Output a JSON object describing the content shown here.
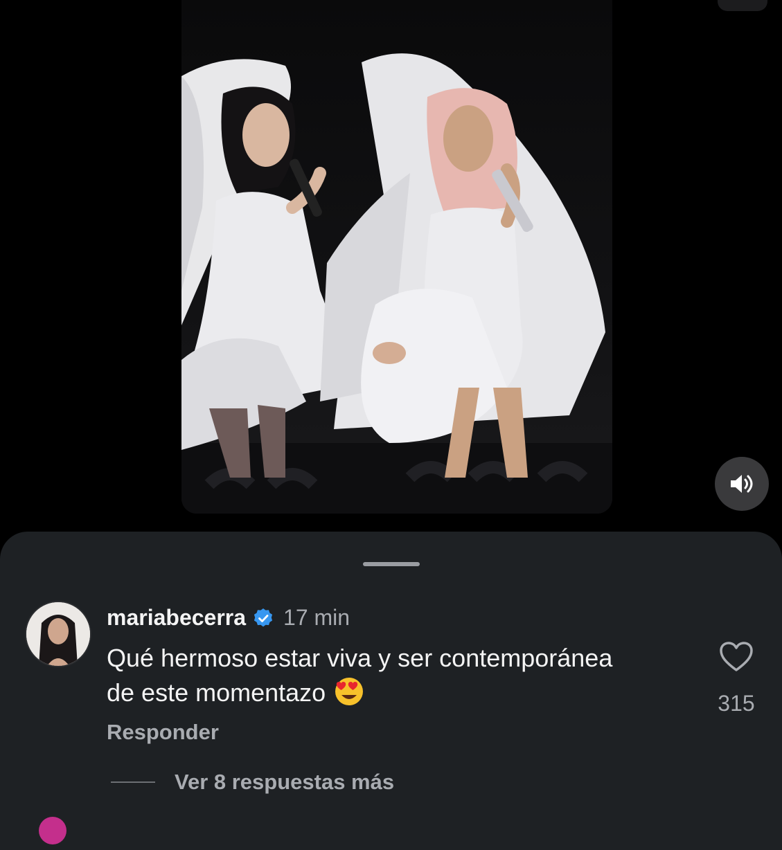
{
  "comment": {
    "username": "mariabecerra",
    "time": "17 min",
    "text": "Qué hermoso estar viva y ser contemporánea de este momentazo",
    "emoji": "heart-eyes-emoji",
    "like_count": "315",
    "reply_label": "Responder",
    "more_replies_label": "Ver 8 respuestas más"
  },
  "icons": {
    "sound": "speaker-icon",
    "verified": "verified-badge-icon",
    "like": "heart-outline-icon"
  },
  "colors": {
    "sheet_bg": "#1e2124",
    "verified_blue": "#3797f0",
    "muted_text": "#a9acb1"
  }
}
